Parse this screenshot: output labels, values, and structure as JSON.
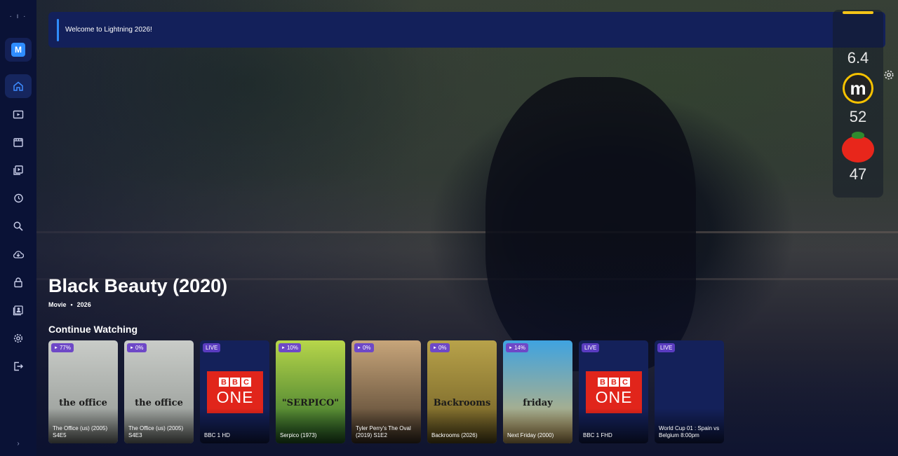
{
  "banner": {
    "message": "Welcome to Lightning 2026!"
  },
  "sidebar": {
    "profile_initial": "M",
    "expand_glyph": "›",
    "items": [
      {
        "icon": "home-icon",
        "active": true
      },
      {
        "icon": "live-tv-icon"
      },
      {
        "icon": "movies-icon"
      },
      {
        "icon": "series-icon"
      },
      {
        "icon": "history-icon"
      },
      {
        "icon": "search-icon"
      },
      {
        "icon": "download-icon"
      },
      {
        "icon": "lock-icon"
      },
      {
        "icon": "contacts-icon"
      },
      {
        "icon": "settings-icon"
      },
      {
        "icon": "logout-icon"
      }
    ]
  },
  "ratings": {
    "imdb": "6.4",
    "metacritic": "52",
    "tomatoes": "47"
  },
  "hero": {
    "title": "Black Beauty (2020)",
    "type": "Movie",
    "separator": "•",
    "year": "2026"
  },
  "continue_watching": {
    "title": "Continue Watching",
    "items": [
      {
        "label": "The Office (us) (2005) S4E5",
        "tag": "77%",
        "kind": "poster",
        "poster_text": "the office",
        "colors": [
          "#c9ccc8",
          "#8f9490"
        ]
      },
      {
        "label": "The Office (us) (2005) S4E3",
        "tag": "0%",
        "kind": "poster",
        "poster_text": "the office",
        "colors": [
          "#c9ccc8",
          "#8f9490"
        ]
      },
      {
        "label": "BBC 1 HD",
        "tag": "LIVE",
        "kind": "bbc"
      },
      {
        "label": "Serpico (1973)",
        "tag": "10%",
        "kind": "poster",
        "poster_text": "\"SERPICO\"",
        "colors": [
          "#b7d64a",
          "#2c6b2a"
        ]
      },
      {
        "label": "Tyler Perry's The Oval (2019) S1E2",
        "tag": "0%",
        "kind": "poster",
        "poster_text": "",
        "colors": [
          "#c7a57a",
          "#4a3a2a"
        ]
      },
      {
        "label": "Backrooms (2026)",
        "tag": "0%",
        "kind": "poster",
        "poster_text": "Backrooms",
        "colors": [
          "#b8a24a",
          "#6b5a22"
        ]
      },
      {
        "label": "Next Friday (2000)",
        "tag": "14%",
        "kind": "poster",
        "poster_text": "friday",
        "colors": [
          "#3fa3e0",
          "#d7b46a"
        ]
      },
      {
        "label": "BBC 1 FHD",
        "tag": "LIVE",
        "kind": "bbc"
      },
      {
        "label": "World Cup 01 : Spain  vs Belgium 8:00pm",
        "tag": "LIVE",
        "kind": "blank"
      }
    ]
  },
  "bbc_logo": {
    "letters": [
      "B",
      "B",
      "C"
    ],
    "word": "ONE"
  },
  "play_glyph": "►",
  "colors": {
    "accent": "#2f8dff",
    "sidebar": "#0a1236",
    "banner": "#13205a",
    "tag": "#6e48c7",
    "bbc_red": "#e1251b"
  }
}
